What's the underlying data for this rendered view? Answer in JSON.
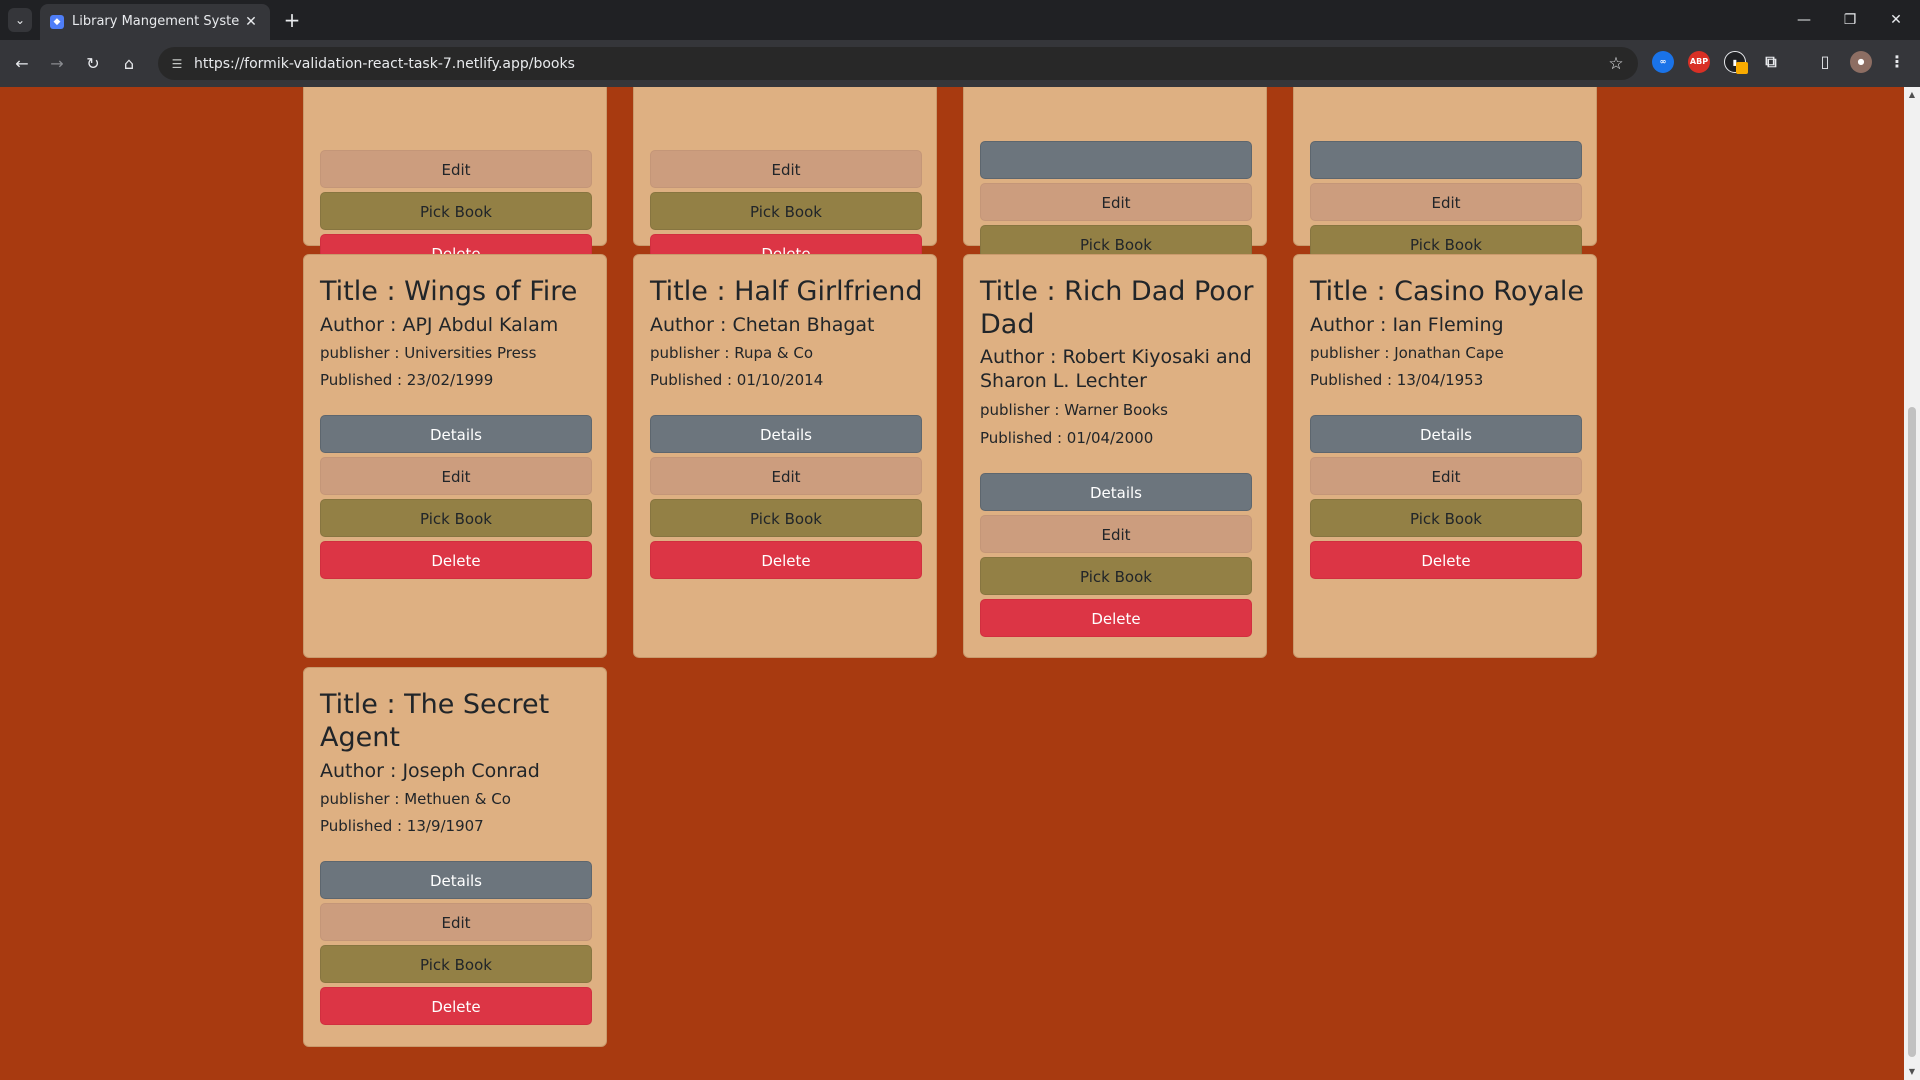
{
  "browser": {
    "tab_title": "Library Mangement System | Sw",
    "url": "https://formik-validation-react-task-7.netlify.app/books",
    "extensions": [
      "abp-icon",
      "extension-icon"
    ]
  },
  "buttons": {
    "details": "Details",
    "edit": "Edit",
    "pick": "Pick Book",
    "delete": "Delete"
  },
  "books": [
    {
      "title": "Title : Wings of Fire",
      "author": "Author : APJ Abdul Kalam",
      "publisher": "publisher : Universities Press",
      "published": "Published : 23/02/1999"
    },
    {
      "title": "Title : Half Girlfriend",
      "author": "Author : Chetan Bhagat",
      "publisher": "publisher : Rupa & Co",
      "published": "Published : 01/10/2014"
    },
    {
      "title": "Title : Rich Dad Poor Dad",
      "author": "Author : Robert Kiyosaki and Sharon L. Lechter",
      "publisher": "publisher : Warner Books",
      "published": "Published : 01/04/2000"
    },
    {
      "title": "Title : Casino Royale",
      "author": "Author : Ian Fleming",
      "publisher": "publisher : Jonathan Cape",
      "published": "Published : 13/04/1953"
    },
    {
      "title": "Title : The Secret Agent",
      "author": "Author : Joseph Conrad",
      "publisher": "publisher : Methuen & Co",
      "published": "Published : 13/9/1907"
    }
  ]
}
